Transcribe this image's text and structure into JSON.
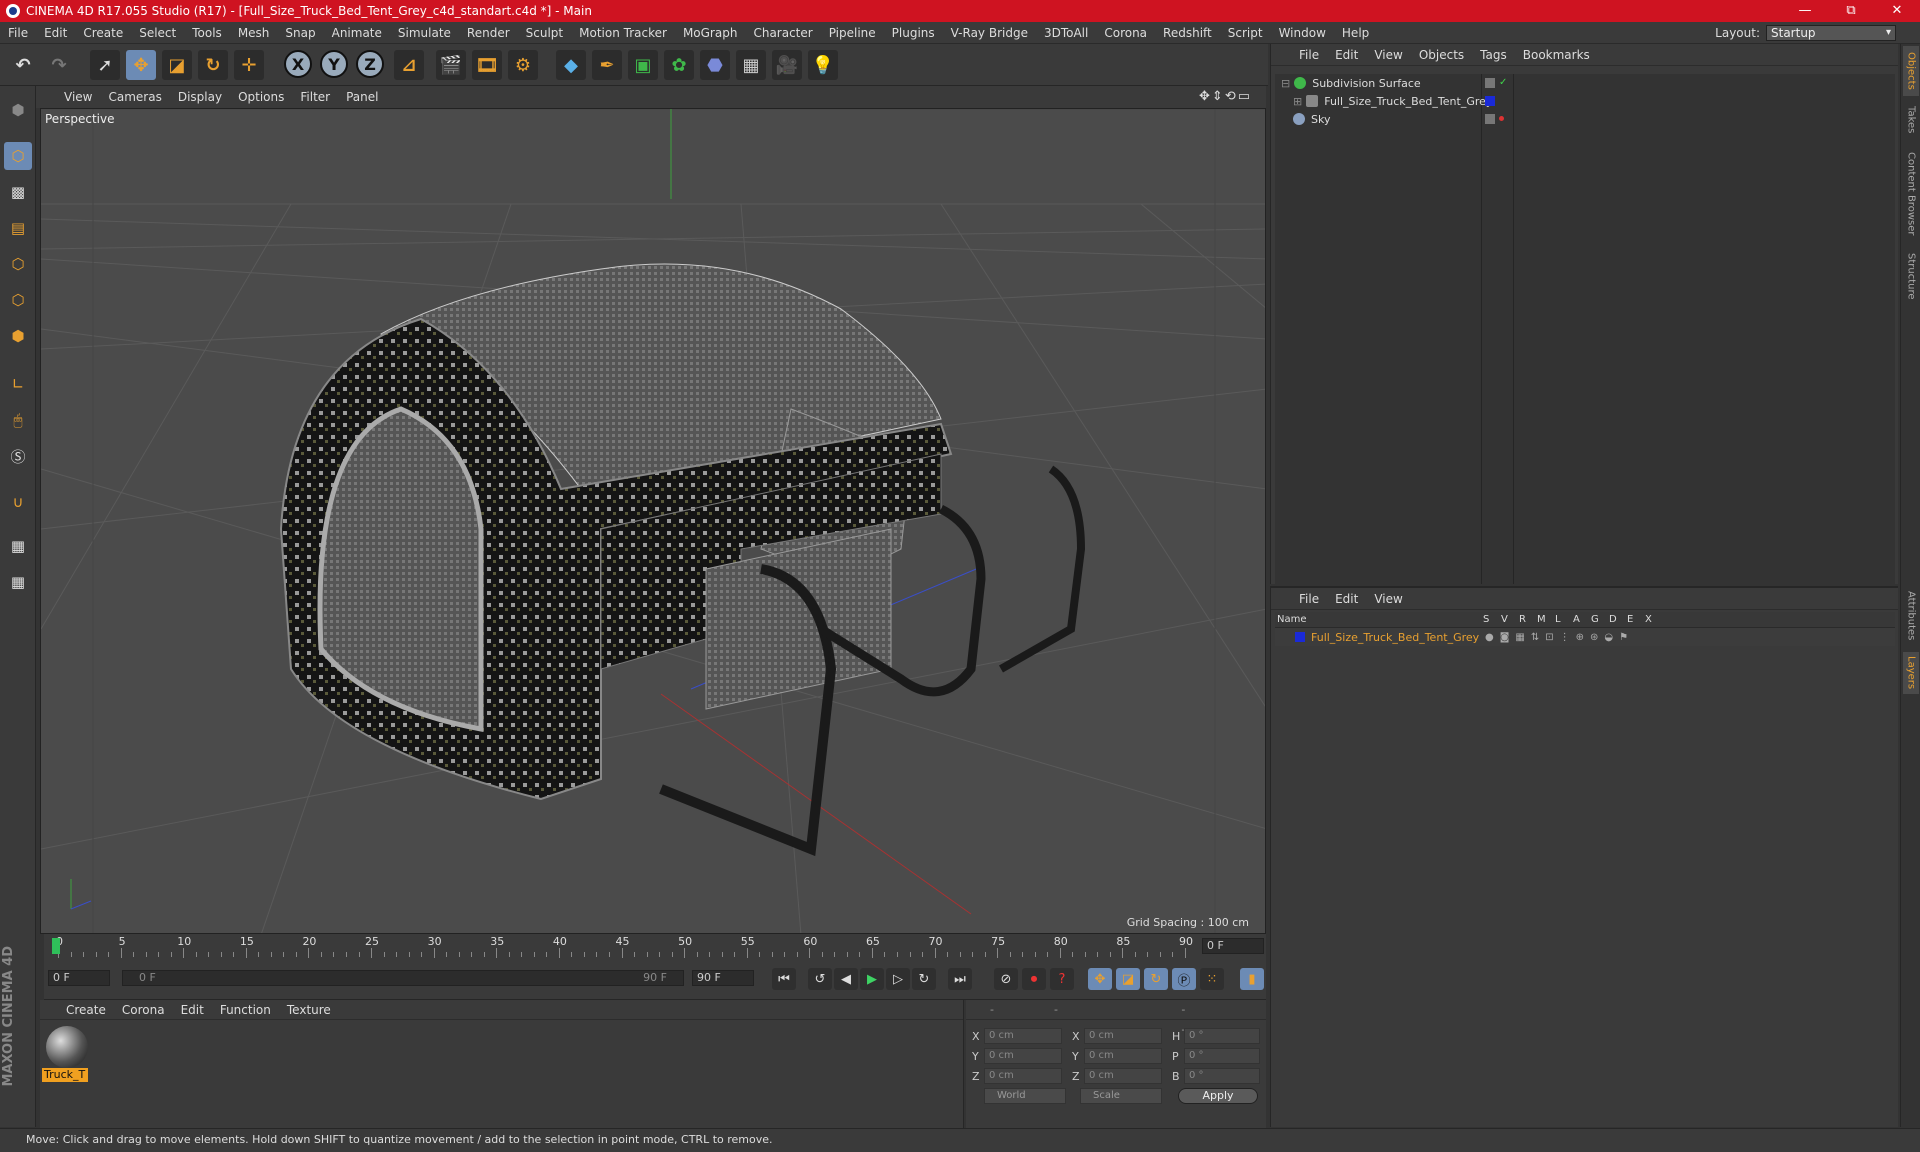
{
  "title_bar": {
    "title": "CINEMA 4D R17.055 Studio (R17) - [Full_Size_Truck_Bed_Tent_Grey_c4d_standart.c4d *] - Main",
    "minimize": "—",
    "maximize": "⧉",
    "close": "✕"
  },
  "menu": [
    "File",
    "Edit",
    "Create",
    "Select",
    "Tools",
    "Mesh",
    "Snap",
    "Animate",
    "Simulate",
    "Render",
    "Sculpt",
    "Motion Tracker",
    "MoGraph",
    "Character",
    "Pipeline",
    "Plugins",
    "V-Ray Bridge",
    "3DToAll",
    "Corona",
    "Redshift",
    "Script",
    "Window",
    "Help"
  ],
  "layout": {
    "label": "Layout:",
    "value": "Startup"
  },
  "toolbar": {
    "x": "X",
    "y": "Y",
    "z": "Z"
  },
  "viewport": {
    "menu": [
      "View",
      "Cameras",
      "Display",
      "Options",
      "Filter",
      "Panel"
    ],
    "label": "Perspective",
    "grid_spacing": "Grid Spacing : 100 cm"
  },
  "timeline": {
    "ticks": [
      "0",
      "5",
      "10",
      "15",
      "20",
      "25",
      "30",
      "35",
      "40",
      "45",
      "50",
      "55",
      "60",
      "65",
      "70",
      "75",
      "80",
      "85",
      "90"
    ],
    "current_frame": "0 F",
    "start_frame": "0 F",
    "slider_start": "0 F",
    "slider_end": "90 F",
    "end_frame": "90 F"
  },
  "material_panel": {
    "menu": [
      "Create",
      "Corona",
      "Edit",
      "Function",
      "Texture"
    ],
    "material_name": "Truck_T"
  },
  "coordinates": {
    "headers": "-- -- --",
    "rows": [
      {
        "a": "X",
        "av": "0 cm",
        "b": "X",
        "bv": "0 cm",
        "c": "H",
        "cv": "0 °"
      },
      {
        "a": "Y",
        "av": "0 cm",
        "b": "Y",
        "bv": "0 cm",
        "c": "P",
        "cv": "0 °"
      },
      {
        "a": "Z",
        "av": "0 cm",
        "b": "Z",
        "bv": "0 cm",
        "c": "B",
        "cv": "0 °"
      }
    ],
    "world": "World",
    "scale": "Scale",
    "apply": "Apply"
  },
  "object_manager": {
    "menu": [
      "File",
      "Edit",
      "View",
      "Objects",
      "Tags",
      "Bookmarks"
    ],
    "objects": [
      {
        "name": "Subdivision Surface",
        "color": "#3fb84a"
      },
      {
        "name": "Full_Size_Truck_Bed_Tent_Grey",
        "color": "#888888"
      },
      {
        "name": "Sky",
        "color": "#8aa0c0"
      }
    ]
  },
  "layer_manager": {
    "menu": [
      "File",
      "Edit",
      "View"
    ],
    "columns": [
      "Name",
      "S",
      "V",
      "R",
      "M",
      "L",
      "A",
      "G",
      "D",
      "E",
      "X"
    ],
    "layer": {
      "name": "Full_Size_Truck_Bed_Tent_Grey",
      "color": "#1a2ad8"
    }
  },
  "right_tabs": [
    "Objects",
    "Takes",
    "Content Browser",
    "Structure",
    "Attributes",
    "Layers"
  ],
  "status": "Move: Click and drag to move elements. Hold down SHIFT to quantize movement / add to the selection in point mode, CTRL to remove.",
  "maxon": "MAXON CINEMA 4D"
}
